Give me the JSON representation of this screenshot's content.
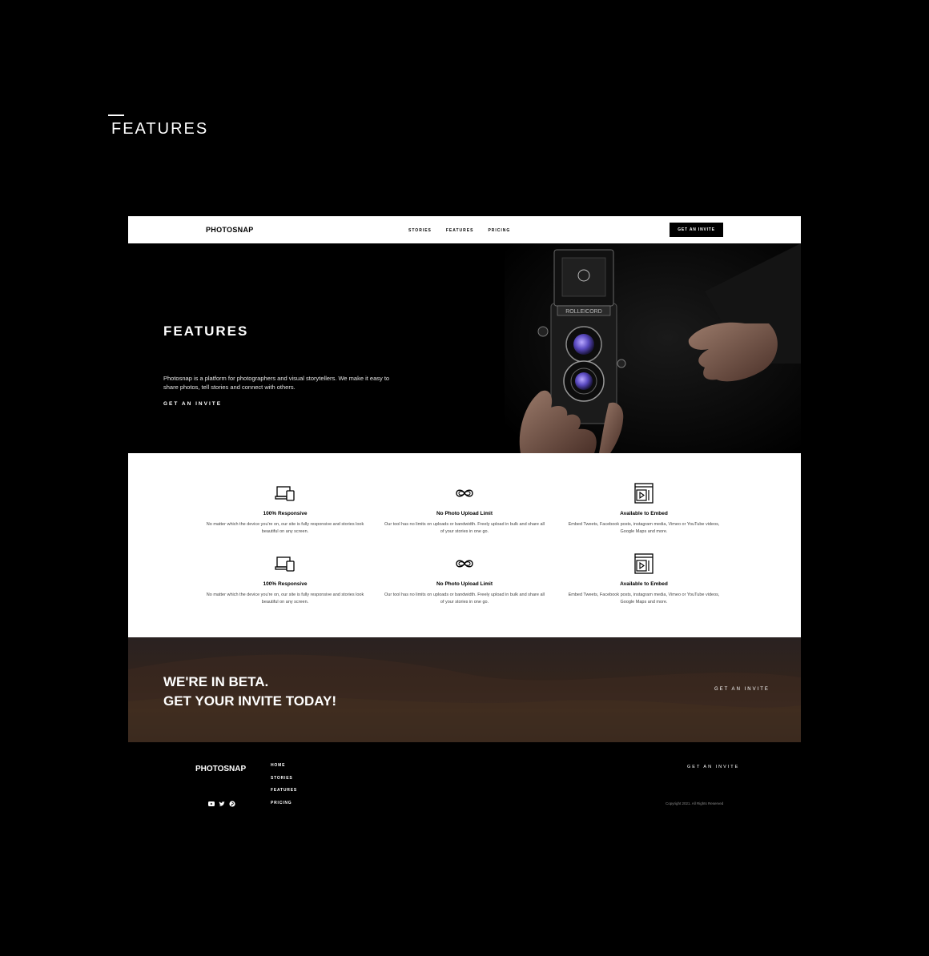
{
  "showcase": {
    "title": "FEATURES"
  },
  "header": {
    "logo": "PHOTOSNAP",
    "nav": [
      "STORIES",
      "FEATURES",
      "PRICING"
    ],
    "cta": "GET AN INVITE"
  },
  "hero": {
    "title": "FEATURES",
    "text": "Photosnap is a platform for photographers and visual storytellers. We make it easy to share photos, tell stories and connect with others.",
    "link": "GET AN INVITE"
  },
  "features": [
    {
      "icon": "responsive-devices-icon",
      "title": "100% Responsive",
      "text": "No matter which the device you're on, our site is fully responsive and stories look beautiful on any screen."
    },
    {
      "icon": "infinity-icon",
      "title": "No Photo Upload Limit",
      "text": "Our tool has no limits on uploads or bandwidth. Freely upload in bulk and share all of your stories in one go."
    },
    {
      "icon": "embed-icon",
      "title": "Available to Embed",
      "text": "Embed Tweets, Facebook posts, instagram media, Vimeo or YouTube videos, Google Maps and more."
    },
    {
      "icon": "responsive-devices-icon",
      "title": "100% Responsive",
      "text": "No matter which the device you're on, our site is fully responsive and stories look beautiful on any screen."
    },
    {
      "icon": "infinity-icon",
      "title": "No Photo Upload Limit",
      "text": "Our tool has no limits on uploads or bandwidth. Freely upload in bulk and share all of your stories in one go."
    },
    {
      "icon": "embed-icon",
      "title": "Available to Embed",
      "text": "Embed Tweets, Facebook posts, instagram media, Vimeo or YouTube videos, Google Maps and more."
    }
  ],
  "beta": {
    "line1": "WE'RE IN BETA.",
    "line2": "GET YOUR INVITE TODAY!",
    "link": "GET AN INVITE"
  },
  "footer": {
    "logo": "PHOTOSNAP",
    "nav": [
      "HOME",
      "STORIES",
      "FEATURES",
      "PRICING"
    ],
    "invite": "GET AN INVITE",
    "copyright": "Copyright 2021. All Rights Reserved",
    "social": [
      "youtube-icon",
      "twitter-icon",
      "pinterest-icon"
    ]
  }
}
